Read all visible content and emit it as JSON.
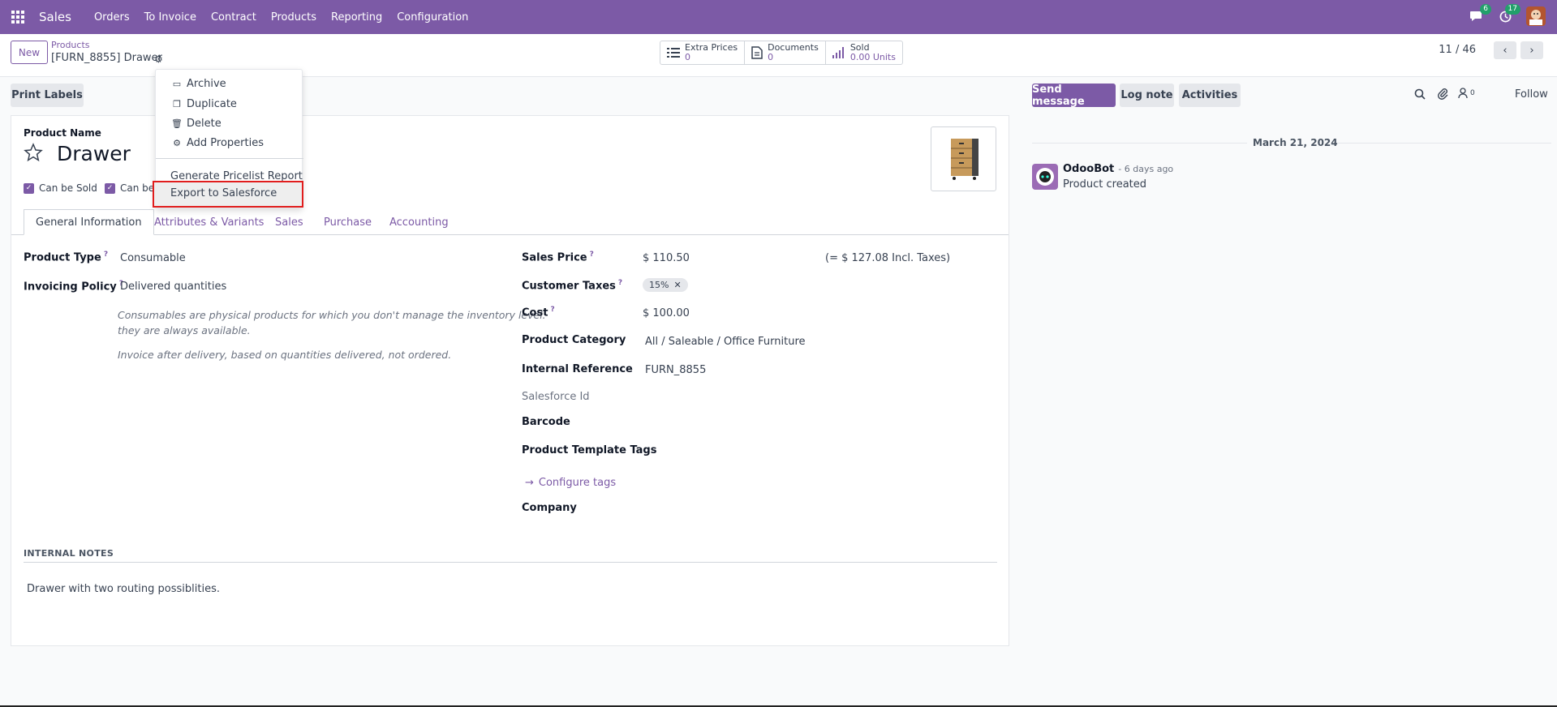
{
  "topbar": {
    "app_name": "Sales",
    "nav": [
      "Orders",
      "To Invoice",
      "Contract",
      "Products",
      "Reporting",
      "Configuration"
    ],
    "messages_badge": "6",
    "activities_badge": "17"
  },
  "control": {
    "new_label": "New",
    "breadcrumb_parent": "Products",
    "breadcrumb_current": "[FURN_8855] Drawer",
    "smart": [
      {
        "label": "Extra Prices",
        "value": "0",
        "icon": "list-icon"
      },
      {
        "label": "Documents",
        "value": "0",
        "icon": "document-icon"
      },
      {
        "label": "Sold",
        "value": "0.00 Units",
        "icon": "bar-chart-icon"
      }
    ],
    "pager": "11 / 46"
  },
  "actions": {
    "print_labels": "Print Labels",
    "send_message": "Send message",
    "log_note": "Log note",
    "activities": "Activities",
    "follow": "Follow",
    "followers_count": "0"
  },
  "dropdown": {
    "items": [
      {
        "label": "Archive",
        "icon": "archive-icon"
      },
      {
        "label": "Duplicate",
        "icon": "copy-icon"
      },
      {
        "label": "Delete",
        "icon": "trash-icon"
      },
      {
        "label": "Add Properties",
        "icon": "gears-icon"
      },
      {
        "label": "Generate Pricelist Report",
        "icon": ""
      },
      {
        "label": "Export to Salesforce",
        "icon": ""
      }
    ]
  },
  "form": {
    "product_name_label": "Product Name",
    "product_name": "Drawer",
    "can_be_sold": "Can be Sold",
    "can_be_purchased_partial": "Can be",
    "tabs": [
      "General Information",
      "Attributes & Variants",
      "Sales",
      "Purchase",
      "Accounting"
    ],
    "left": {
      "product_type_label": "Product Type",
      "product_type": "Consumable",
      "invoicing_policy_label": "Invoicing Policy",
      "invoicing_policy": "Delivered quantities",
      "help_1_line1": "Consumables are physical products for which you don't manage the inventory level:",
      "help_1_line2": "they are always available.",
      "help_2": "Invoice after delivery, based on quantities delivered, not ordered."
    },
    "right": {
      "sales_price_label": "Sales Price",
      "sales_price": "$ 110.50",
      "incl_taxes": "(= $ 127.08 Incl. Taxes)",
      "customer_taxes_label": "Customer Taxes",
      "customer_taxes_tag": "15%",
      "cost_label": "Cost",
      "cost": "$ 100.00",
      "category_label": "Product Category",
      "category": "All / Saleable / Office Furniture",
      "internal_ref_label": "Internal Reference",
      "internal_ref": "FURN_8855",
      "salesforce_label": "Salesforce Id",
      "barcode_label": "Barcode",
      "template_tags_label": "Product Template Tags",
      "configure_tags": "Configure tags",
      "company_label": "Company"
    },
    "internal_notes_label": "INTERNAL NOTES",
    "internal_notes": "Drawer with two routing possiblities."
  },
  "chatter": {
    "date": "March 21, 2024",
    "author": "OdooBot",
    "time": "- 6 days ago",
    "message": "Product created"
  }
}
